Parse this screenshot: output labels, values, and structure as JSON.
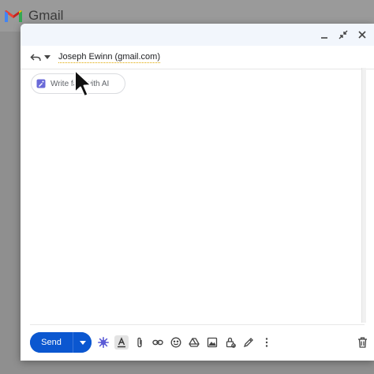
{
  "background_app": {
    "logo_text": "Gmail"
  },
  "compose": {
    "window_controls": [
      "minimize-icon",
      "exit-fullscreen-icon",
      "close-icon"
    ],
    "recipient": "Joseph Ewinn (gmail.com)",
    "ai_chip": {
      "label": "Write fast with AI",
      "icon": "pen-spark-icon"
    },
    "toolbar": {
      "send_label": "Send",
      "icons": [
        "spark-icon",
        "formatting-icon",
        "attach-icon",
        "link-icon",
        "emoji-icon",
        "drive-icon",
        "photo-icon",
        "confidential-icon",
        "signature-icon",
        "more-options-icon"
      ],
      "trash_icon": "trash-icon"
    }
  },
  "colors": {
    "send": "#0b57d0",
    "spark": "#5b5bd6",
    "gmail_red": "#ea4335"
  }
}
